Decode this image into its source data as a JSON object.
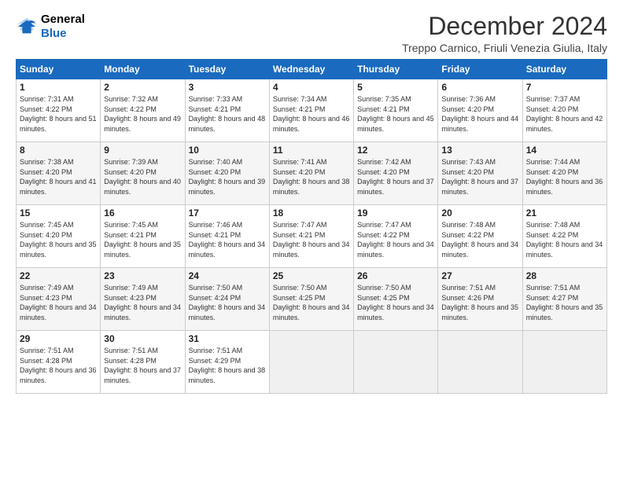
{
  "header": {
    "logo_line1": "General",
    "logo_line2": "Blue",
    "title": "December 2024",
    "subtitle": "Treppo Carnico, Friuli Venezia Giulia, Italy"
  },
  "days_of_week": [
    "Sunday",
    "Monday",
    "Tuesday",
    "Wednesday",
    "Thursday",
    "Friday",
    "Saturday"
  ],
  "weeks": [
    [
      {
        "day": 1,
        "sunrise": "7:31 AM",
        "sunset": "4:22 PM",
        "daylight": "8 hours and 51 minutes."
      },
      {
        "day": 2,
        "sunrise": "7:32 AM",
        "sunset": "4:22 PM",
        "daylight": "8 hours and 49 minutes."
      },
      {
        "day": 3,
        "sunrise": "7:33 AM",
        "sunset": "4:21 PM",
        "daylight": "8 hours and 48 minutes."
      },
      {
        "day": 4,
        "sunrise": "7:34 AM",
        "sunset": "4:21 PM",
        "daylight": "8 hours and 46 minutes."
      },
      {
        "day": 5,
        "sunrise": "7:35 AM",
        "sunset": "4:21 PM",
        "daylight": "8 hours and 45 minutes."
      },
      {
        "day": 6,
        "sunrise": "7:36 AM",
        "sunset": "4:20 PM",
        "daylight": "8 hours and 44 minutes."
      },
      {
        "day": 7,
        "sunrise": "7:37 AM",
        "sunset": "4:20 PM",
        "daylight": "8 hours and 42 minutes."
      }
    ],
    [
      {
        "day": 8,
        "sunrise": "7:38 AM",
        "sunset": "4:20 PM",
        "daylight": "8 hours and 41 minutes."
      },
      {
        "day": 9,
        "sunrise": "7:39 AM",
        "sunset": "4:20 PM",
        "daylight": "8 hours and 40 minutes."
      },
      {
        "day": 10,
        "sunrise": "7:40 AM",
        "sunset": "4:20 PM",
        "daylight": "8 hours and 39 minutes."
      },
      {
        "day": 11,
        "sunrise": "7:41 AM",
        "sunset": "4:20 PM",
        "daylight": "8 hours and 38 minutes."
      },
      {
        "day": 12,
        "sunrise": "7:42 AM",
        "sunset": "4:20 PM",
        "daylight": "8 hours and 37 minutes."
      },
      {
        "day": 13,
        "sunrise": "7:43 AM",
        "sunset": "4:20 PM",
        "daylight": "8 hours and 37 minutes."
      },
      {
        "day": 14,
        "sunrise": "7:44 AM",
        "sunset": "4:20 PM",
        "daylight": "8 hours and 36 minutes."
      }
    ],
    [
      {
        "day": 15,
        "sunrise": "7:45 AM",
        "sunset": "4:20 PM",
        "daylight": "8 hours and 35 minutes."
      },
      {
        "day": 16,
        "sunrise": "7:45 AM",
        "sunset": "4:21 PM",
        "daylight": "8 hours and 35 minutes."
      },
      {
        "day": 17,
        "sunrise": "7:46 AM",
        "sunset": "4:21 PM",
        "daylight": "8 hours and 34 minutes."
      },
      {
        "day": 18,
        "sunrise": "7:47 AM",
        "sunset": "4:21 PM",
        "daylight": "8 hours and 34 minutes."
      },
      {
        "day": 19,
        "sunrise": "7:47 AM",
        "sunset": "4:22 PM",
        "daylight": "8 hours and 34 minutes."
      },
      {
        "day": 20,
        "sunrise": "7:48 AM",
        "sunset": "4:22 PM",
        "daylight": "8 hours and 34 minutes."
      },
      {
        "day": 21,
        "sunrise": "7:48 AM",
        "sunset": "4:22 PM",
        "daylight": "8 hours and 34 minutes."
      }
    ],
    [
      {
        "day": 22,
        "sunrise": "7:49 AM",
        "sunset": "4:23 PM",
        "daylight": "8 hours and 34 minutes."
      },
      {
        "day": 23,
        "sunrise": "7:49 AM",
        "sunset": "4:23 PM",
        "daylight": "8 hours and 34 minutes."
      },
      {
        "day": 24,
        "sunrise": "7:50 AM",
        "sunset": "4:24 PM",
        "daylight": "8 hours and 34 minutes."
      },
      {
        "day": 25,
        "sunrise": "7:50 AM",
        "sunset": "4:25 PM",
        "daylight": "8 hours and 34 minutes."
      },
      {
        "day": 26,
        "sunrise": "7:50 AM",
        "sunset": "4:25 PM",
        "daylight": "8 hours and 34 minutes."
      },
      {
        "day": 27,
        "sunrise": "7:51 AM",
        "sunset": "4:26 PM",
        "daylight": "8 hours and 35 minutes."
      },
      {
        "day": 28,
        "sunrise": "7:51 AM",
        "sunset": "4:27 PM",
        "daylight": "8 hours and 35 minutes."
      }
    ],
    [
      {
        "day": 29,
        "sunrise": "7:51 AM",
        "sunset": "4:28 PM",
        "daylight": "8 hours and 36 minutes."
      },
      {
        "day": 30,
        "sunrise": "7:51 AM",
        "sunset": "4:28 PM",
        "daylight": "8 hours and 37 minutes."
      },
      {
        "day": 31,
        "sunrise": "7:51 AM",
        "sunset": "4:29 PM",
        "daylight": "8 hours and 38 minutes."
      },
      null,
      null,
      null,
      null
    ]
  ]
}
